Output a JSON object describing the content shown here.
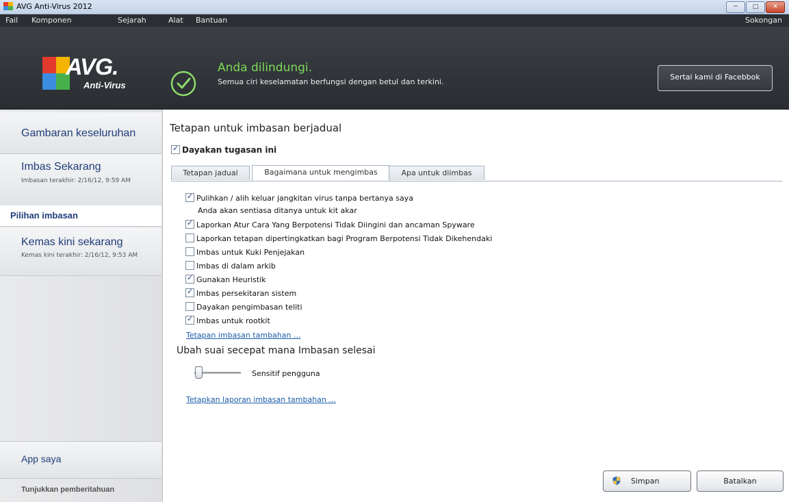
{
  "window": {
    "title": "AVG Anti-Virus 2012"
  },
  "menu": {
    "items": [
      "Fail",
      "Komponen",
      "Sejarah",
      "Alat",
      "Bantuan"
    ],
    "help": "Sokongan"
  },
  "header": {
    "logo_text": "AVG.",
    "logo_sub": "Anti-Virus",
    "status_title": "Anda dilindungi.",
    "status_sub": "Semua ciri keselamatan berfungsi dengan betul dan terkini.",
    "facebook_button": "Sertai kami di Facebbok"
  },
  "sidebar": {
    "overview": "Gambaran keseluruhan",
    "scan_now": "Imbas Sekarang",
    "scan_now_sub": "Imbasan terakhir: 2/16/12, 9:59 AM",
    "scan_options": "Pilihan imbasan",
    "update_now": "Kemas kini sekarang",
    "update_now_sub": "Kemas kini terakhir: 2/16/12, 9:53 AM",
    "my_apps": "App saya",
    "notifications": "Tunjukkan pemberitahuan"
  },
  "main": {
    "title": "Tetapan untuk imbasan berjadual",
    "enable_task": "Dayakan tugasan ini",
    "enable_task_checked": true,
    "tabs": [
      "Tetapan jadual",
      "Bagaimana untuk mengimbas",
      "Apa untuk diimbas"
    ],
    "active_tab": 1,
    "options": [
      {
        "label": "Pulihkan / alih keluar jangkitan virus tanpa bertanya saya",
        "checked": true
      },
      {
        "label": "Laporkan Atur Cara Yang Berpotensi Tidak Diingini dan ancaman Spyware",
        "checked": true
      },
      {
        "label": "Laporkan tetapan dipertingkatkan bagi Program Berpotensi Tidak Dikehendaki",
        "checked": false
      },
      {
        "label": "Imbas untuk Kuki Penjejakan",
        "checked": false
      },
      {
        "label": "Imbas di dalam arkib",
        "checked": false
      },
      {
        "label": "Gunakan Heuristik",
        "checked": true
      },
      {
        "label": "Imbas persekitaran sistem",
        "checked": true
      },
      {
        "label": "Dayakan pengimbasan teliti",
        "checked": false
      },
      {
        "label": "Imbas untuk rootkit",
        "checked": true
      }
    ],
    "rootkit_note": "Anda akan sentiasa ditanya untuk kit akar",
    "extra_settings_link": "Tetapan imbasan tambahan ...",
    "speed_heading": "Ubah suai secepat mana Imbasan selesai",
    "speed_label": "Sensitif pengguna",
    "speed_level": 0,
    "report_link": "Tetapkan laporan imbasan tambahan ...",
    "save_button": "Simpan",
    "cancel_button": "Batalkan"
  }
}
